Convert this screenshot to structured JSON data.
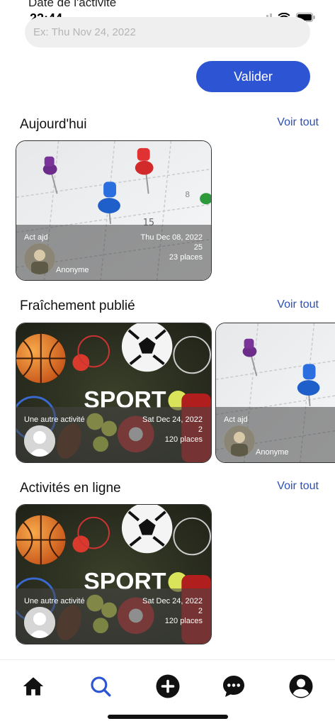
{
  "status": {
    "partial_title": "Date de l'activité",
    "time": "23:44"
  },
  "search": {
    "placeholder": "Ex: Thu Nov 24, 2022",
    "validate_label": "Valider"
  },
  "sections": [
    {
      "title": "Aujourd'hui",
      "see_all": "Voir tout",
      "cards": [
        {
          "name": "Act ajd",
          "date": "Thu Dec 08, 2022",
          "count": "25",
          "places": "23 places",
          "user": "Anonyme",
          "image": "calendar-pins-image"
        }
      ]
    },
    {
      "title": "Fraîchement publié",
      "see_all": "Voir tout",
      "cards": [
        {
          "name": "Une autre activité",
          "date": "Sat Dec 24, 2022",
          "count": "2",
          "places": "120 places",
          "user": "",
          "image": "sport-balls-image",
          "sport_text": "SPORT"
        },
        {
          "name": "Act ajd",
          "date": "",
          "count": "",
          "places": "",
          "user": "Anonyme",
          "image": "calendar-pins-image"
        }
      ]
    },
    {
      "title": "Activités en ligne",
      "see_all": "Voir tout",
      "cards": [
        {
          "name": "Une autre activité",
          "date": "Sat Dec 24, 2022",
          "count": "2",
          "places": "120 places",
          "user": "",
          "image": "sport-balls-image",
          "sport_text": "SPORT"
        }
      ]
    }
  ],
  "tabs": [
    {
      "icon": "home-icon"
    },
    {
      "icon": "search-icon",
      "active": true
    },
    {
      "icon": "add-circle-icon"
    },
    {
      "icon": "chat-icon"
    },
    {
      "icon": "profile-icon"
    }
  ],
  "colors": {
    "accent": "#2d54d3",
    "link": "#2d4fb8",
    "input_bg": "#efefef"
  }
}
